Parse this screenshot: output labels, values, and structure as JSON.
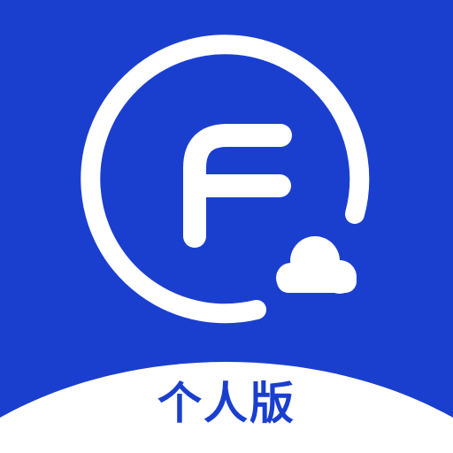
{
  "app_icon": {
    "edition_label": "个人版",
    "colors": {
      "background": "#1A3FCF",
      "logo_stroke": "#FFFFFF",
      "bottom_band": "#FFFFFF",
      "label": "#1A3FCF"
    },
    "icons": [
      "letter-f-logo-icon",
      "cloud-icon"
    ]
  }
}
